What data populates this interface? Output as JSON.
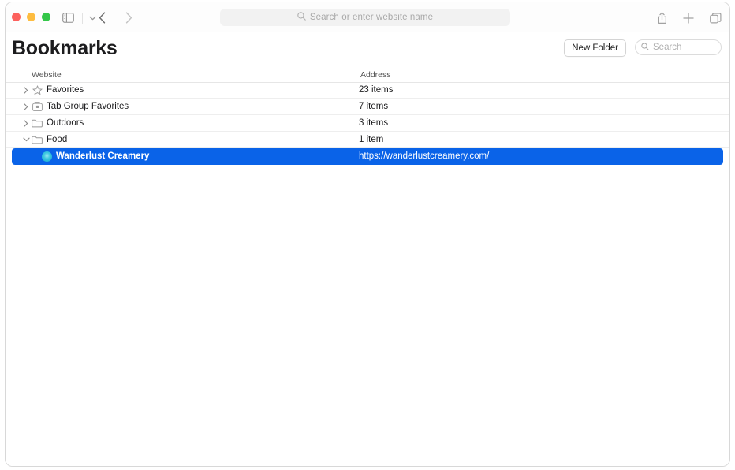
{
  "window": {
    "traffic_lights": [
      {
        "name": "close",
        "color": "#fc615d"
      },
      {
        "name": "minimize",
        "color": "#fdbc40"
      },
      {
        "name": "zoom",
        "color": "#34c749"
      }
    ]
  },
  "toolbar": {
    "sidebar_toggle_icon": "sidebar-icon",
    "sidebar_chevron_icon": "chevron-down-icon",
    "back_icon": "chevron-left-icon",
    "forward_icon": "chevron-right-icon",
    "address_bar": {
      "placeholder": "Search or enter website name",
      "value": "",
      "search_icon": "search-icon"
    },
    "share_icon": "share-icon",
    "new_tab_icon": "plus-icon",
    "tab_overview_icon": "tab-overview-icon"
  },
  "header": {
    "title": "Bookmarks",
    "new_folder_label": "New Folder",
    "search": {
      "placeholder": "Search",
      "value": "",
      "search_icon": "search-icon"
    }
  },
  "table": {
    "columns": [
      {
        "key": "website",
        "label": "Website"
      },
      {
        "key": "address",
        "label": "Address"
      }
    ],
    "rows": [
      {
        "name": "Favorites",
        "address": "23 items",
        "icon": "star-icon",
        "disclosure": "chevron-right-icon",
        "expanded": false,
        "selected": false,
        "child": false
      },
      {
        "name": "Tab Group Favorites",
        "address": "7 items",
        "icon": "tab-group-icon",
        "disclosure": "chevron-right-icon",
        "expanded": false,
        "selected": false,
        "child": false
      },
      {
        "name": "Outdoors",
        "address": "3 items",
        "icon": "folder-icon",
        "disclosure": "chevron-right-icon",
        "expanded": false,
        "selected": false,
        "child": false
      },
      {
        "name": "Food",
        "address": "1 item",
        "icon": "folder-icon",
        "disclosure": "chevron-down-icon",
        "expanded": true,
        "selected": false,
        "child": false
      },
      {
        "name": "Wanderlust Creamery",
        "address": "https://wanderlustcreamery.com/",
        "icon": "website-favicon",
        "disclosure": "",
        "expanded": false,
        "selected": true,
        "child": true
      }
    ]
  },
  "colors": {
    "selection_blue": "#0a63e8",
    "favicon_teal": "#14a7cd",
    "title_text": "#1c1c1e"
  }
}
